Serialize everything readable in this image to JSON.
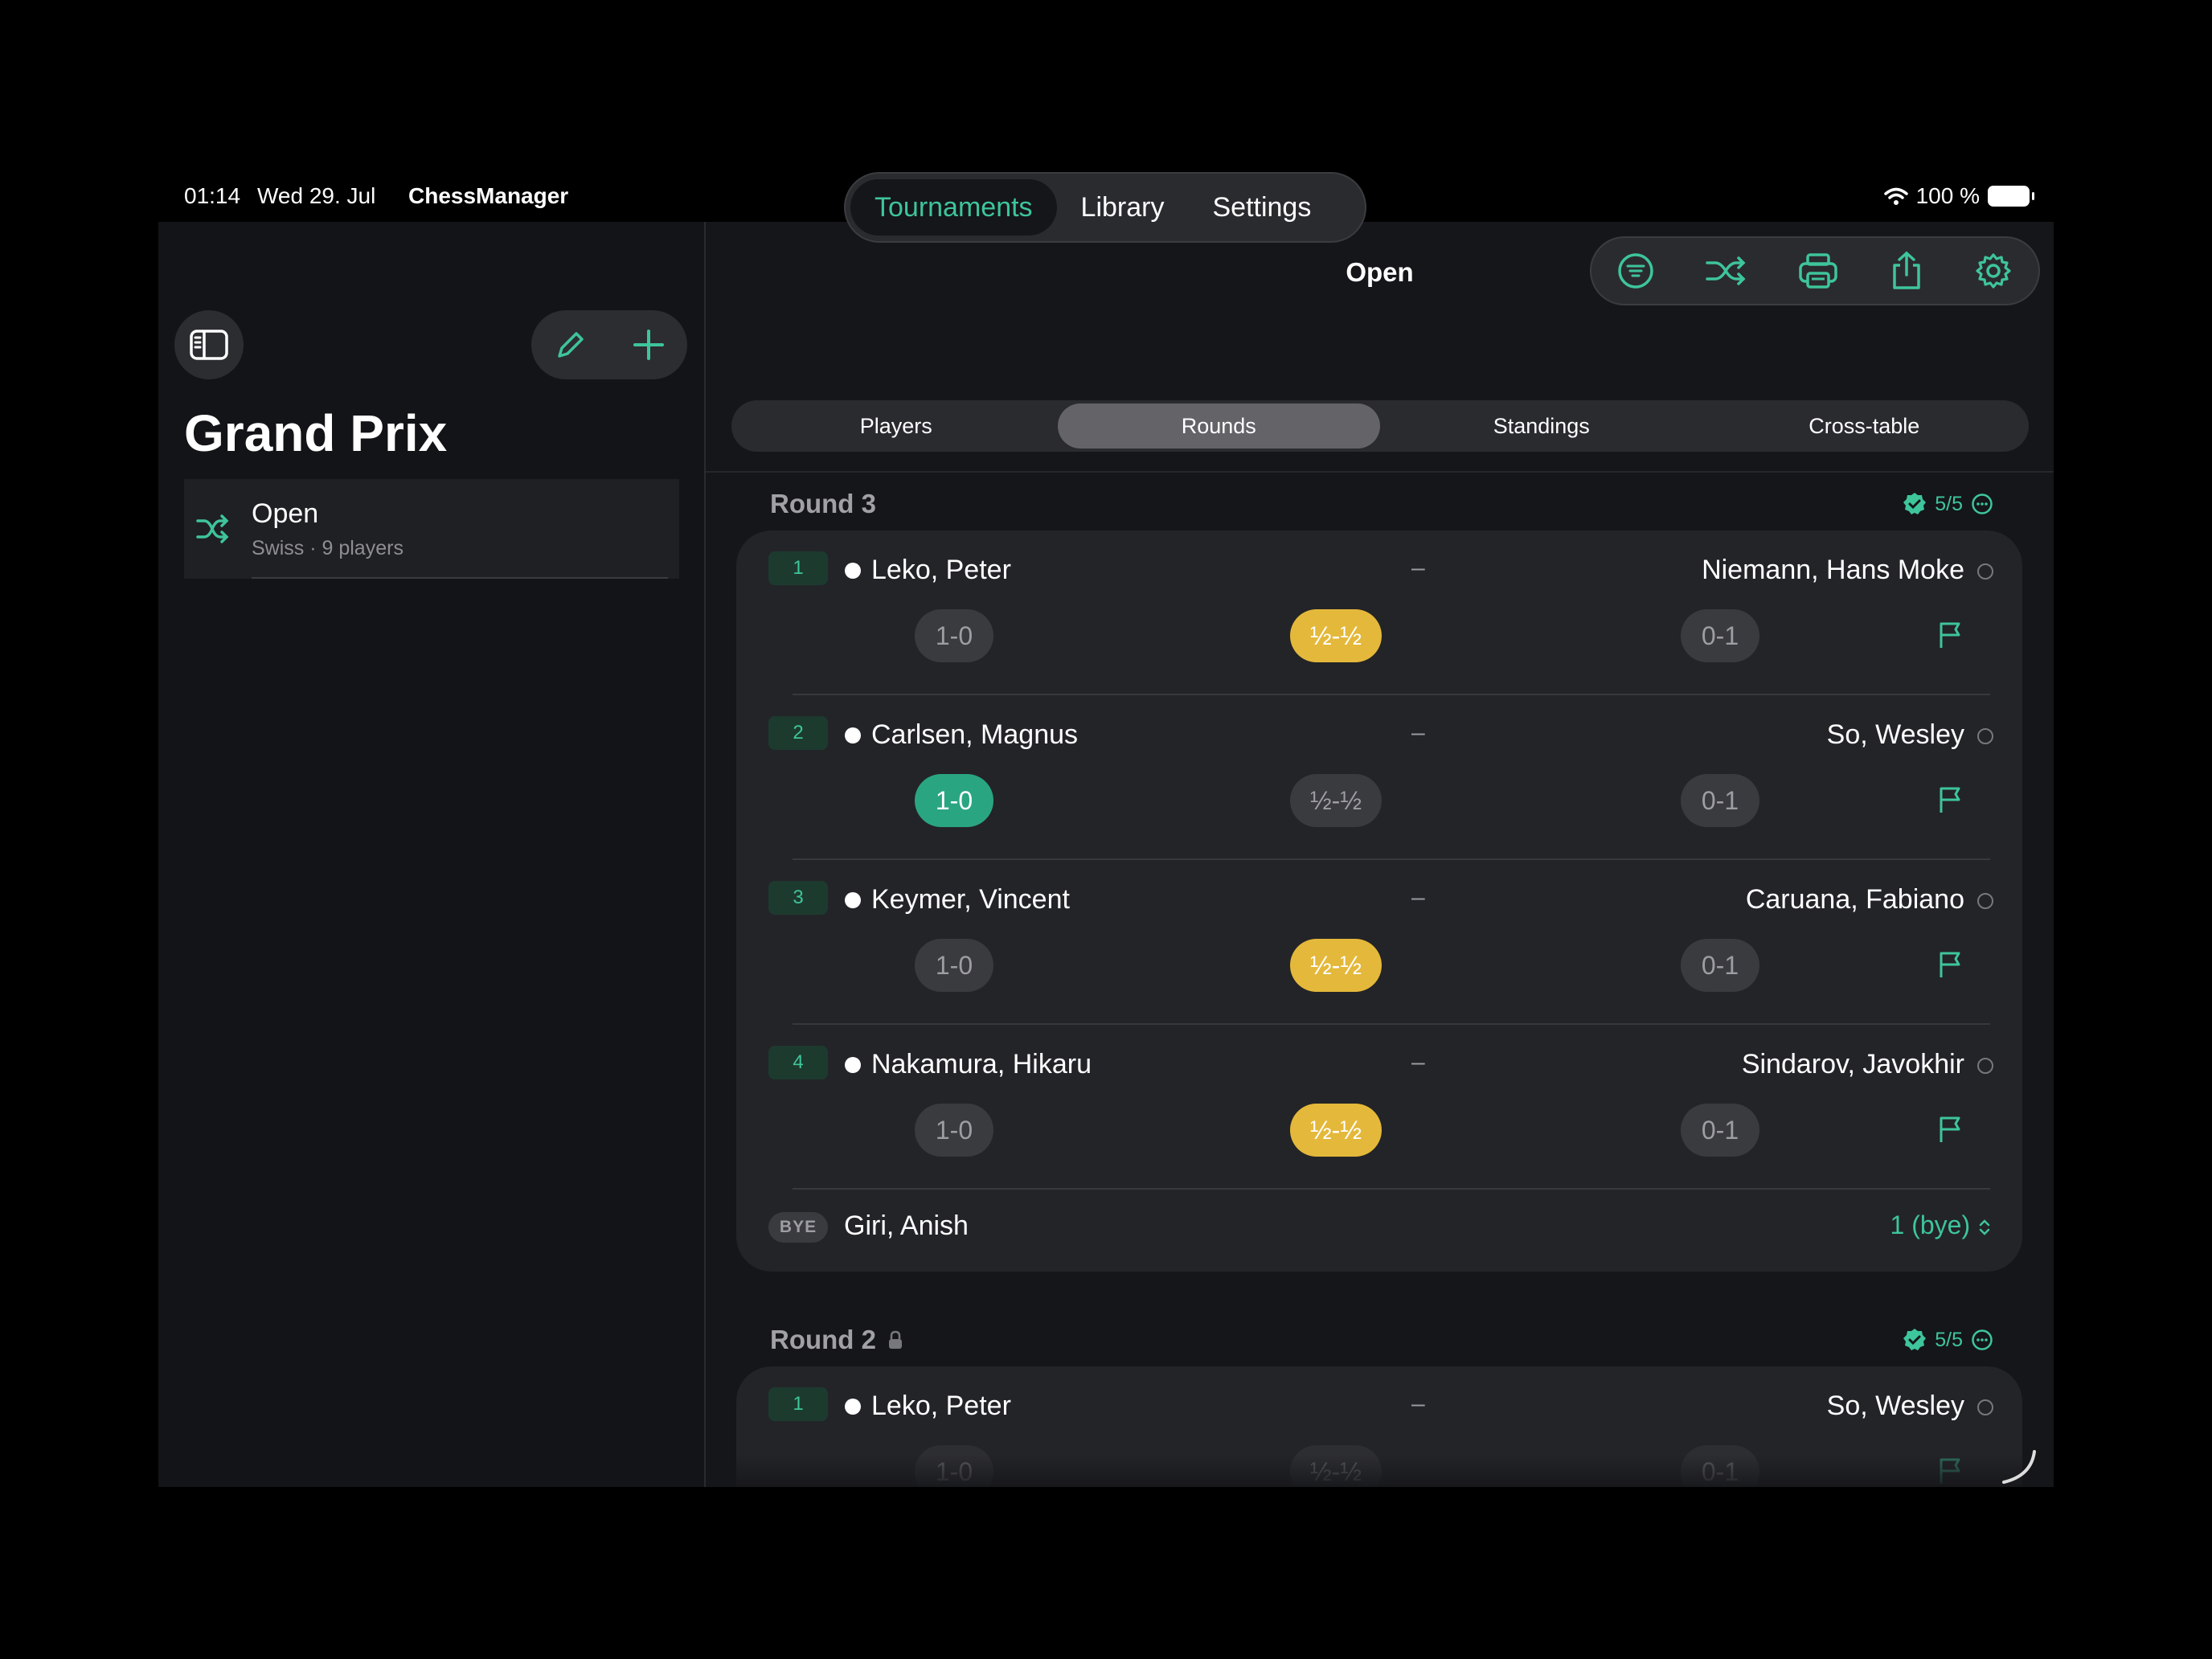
{
  "status_bar": {
    "time": "01:14",
    "date": "Wed 29. Jul",
    "app": "ChessManager",
    "battery": "100 %"
  },
  "sidebar": {
    "title": "Grand Prix",
    "items": [
      {
        "title": "Open",
        "subtitle": "Swiss · 9 players",
        "icon": "shuffle-icon"
      }
    ]
  },
  "top_tabs": [
    {
      "label": "Tournaments",
      "active": true
    },
    {
      "label": "Library",
      "active": false
    },
    {
      "label": "Settings",
      "active": false
    }
  ],
  "main": {
    "title": "Open",
    "toolbar_icons": [
      "filter-icon",
      "shuffle-icon",
      "print-icon",
      "share-icon",
      "gear-icon"
    ]
  },
  "segments": [
    {
      "label": "Players",
      "active": false
    },
    {
      "label": "Rounds",
      "active": true
    },
    {
      "label": "Standings",
      "active": false
    },
    {
      "label": "Cross-table",
      "active": false
    }
  ],
  "result_labels": {
    "white": "1-0",
    "draw": "½-½",
    "black": "0-1",
    "dash": "–"
  },
  "rounds": [
    {
      "title": "Round 3",
      "locked": false,
      "status": "5/5",
      "pairings": [
        {
          "board": "1",
          "white": "Leko, Peter",
          "black": "Niemann, Hans Moke",
          "result": "draw"
        },
        {
          "board": "2",
          "white": "Carlsen, Magnus",
          "black": "So, Wesley",
          "result": "white"
        },
        {
          "board": "3",
          "white": "Keymer, Vincent",
          "black": "Caruana, Fabiano",
          "result": "draw"
        },
        {
          "board": "4",
          "white": "Nakamura, Hikaru",
          "black": "Sindarov, Javokhir",
          "result": "draw"
        }
      ],
      "bye": {
        "badge": "BYE",
        "player": "Giri, Anish",
        "result": "1 (bye)"
      }
    },
    {
      "title": "Round 2",
      "locked": true,
      "status": "5/5",
      "pairings": [
        {
          "board": "1",
          "white": "Leko, Peter",
          "black": "So, Wesley",
          "result": "none"
        }
      ]
    }
  ],
  "colors": {
    "accent": "#3ec59a",
    "draw": "#e4b83a",
    "win": "#2aa582"
  }
}
